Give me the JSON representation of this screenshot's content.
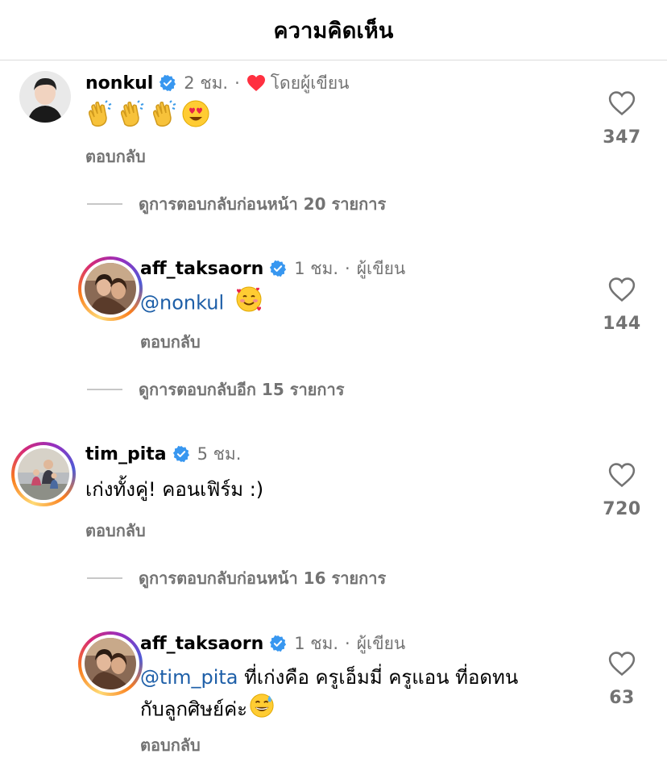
{
  "header": {
    "title": "ความคิดเห็น"
  },
  "comments": [
    {
      "username": "nonkul",
      "time": "2 ชม.",
      "separator": "·",
      "badge": "โดยผู้เขียน",
      "text": "",
      "emojis": [
        "clapping-hands",
        "clapping-hands",
        "clapping-hands",
        "heart-eyes"
      ],
      "reply_label": "ตอบกลับ",
      "likes": "347",
      "view_replies": "ดูการตอบกลับก่อนหน้า 20 รายการ"
    },
    {
      "username": "aff_taksaorn",
      "time": "1 ชม.",
      "separator": "·",
      "badge": "ผู้เขียน",
      "mention": "@nonkul",
      "emojis": [
        "smiling-face-with-hearts"
      ],
      "reply_label": "ตอบกลับ",
      "likes": "144",
      "view_replies": "ดูการตอบกลับอีก 15 รายการ"
    },
    {
      "username": "tim_pita",
      "time": "5 ชม.",
      "text": "เก่งทั้งคู่! คอนเฟิร์ม :)",
      "reply_label": "ตอบกลับ",
      "likes": "720",
      "view_replies": "ดูการตอบกลับก่อนหน้า 16 รายการ"
    },
    {
      "username": "aff_taksaorn",
      "time": "1 ชม.",
      "separator": "·",
      "badge": "ผู้เขียน",
      "mention": "@tim_pita",
      "text_line1": " ที่เก่งคือ ครูเอ็มมี่ ครูแอน ที่อดทน",
      "text_line2": "กับลูกศิษย์ค่ะ",
      "emojis": [
        "grinning-sweat"
      ],
      "reply_label": "ตอบกลับ",
      "likes": "63"
    }
  ],
  "colors": {
    "verified": "#3897f0",
    "heart": "#ff3040",
    "mention": "#00376b"
  }
}
